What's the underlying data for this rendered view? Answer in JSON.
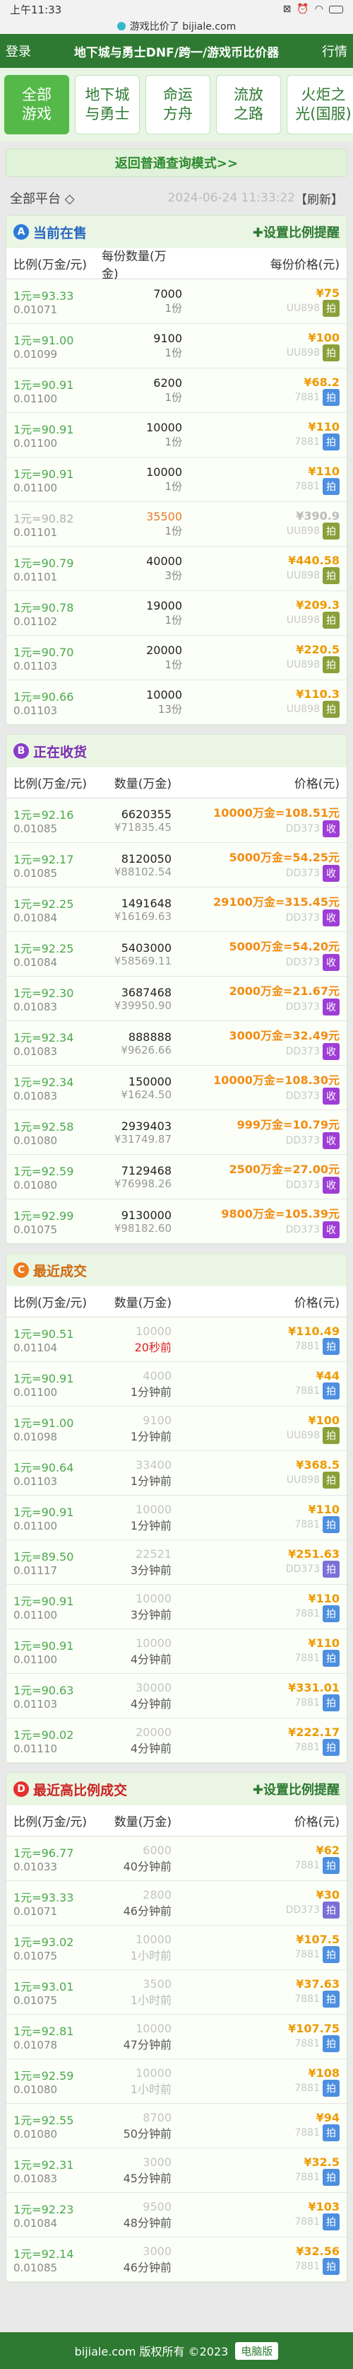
{
  "status": {
    "time": "上午11:33"
  },
  "url": {
    "text": "游戏比价了 bijiale.com"
  },
  "nav": {
    "login": "登录",
    "title": "地下城与勇士DNF/跨一/游戏币比价器",
    "rank": "行情"
  },
  "tabs": [
    "全部\n游戏",
    "地下城\n与勇士",
    "命运\n方舟",
    "流放\n之路",
    "火炬之\n光(国服)"
  ],
  "back_link": "返回普通查询模式>>",
  "filter": {
    "platform": "全部平台 ◇",
    "timestamp": "2024-06-24 11:33:22",
    "refresh": "【刷新】"
  },
  "sell": {
    "letter": "A",
    "title": "当前在售",
    "set_label": "✚设置比例提醒",
    "cols": [
      "比例(万金/元)",
      "每份数量(万金)",
      "每份价格(元)"
    ],
    "rows": [
      {
        "ratio": "1元=93.33",
        "sub": "0.01071",
        "qty": "7000",
        "share": "1份",
        "price": "¥75",
        "store": "UU898",
        "badge": "拍",
        "bc": "b-g",
        "gray": false
      },
      {
        "ratio": "1元=91.00",
        "sub": "0.01099",
        "qty": "9100",
        "share": "1份",
        "price": "¥100",
        "store": "UU898",
        "badge": "拍",
        "bc": "b-g",
        "gray": false
      },
      {
        "ratio": "1元=90.91",
        "sub": "0.01100",
        "qty": "6200",
        "share": "1份",
        "price": "¥68.2",
        "store": "7881",
        "badge": "拍",
        "bc": "b-b",
        "gray": false
      },
      {
        "ratio": "1元=90.91",
        "sub": "0.01100",
        "qty": "10000",
        "share": "1份",
        "price": "¥110",
        "store": "7881",
        "badge": "拍",
        "bc": "b-b",
        "gray": false
      },
      {
        "ratio": "1元=90.91",
        "sub": "0.01100",
        "qty": "10000",
        "share": "1份",
        "price": "¥110",
        "store": "7881",
        "badge": "拍",
        "bc": "b-b",
        "gray": false
      },
      {
        "ratio": "1元=90.82",
        "sub": "0.01101",
        "qty": "35500",
        "share": "1份",
        "price": "¥390.9",
        "store": "UU898",
        "badge": "拍",
        "bc": "b-g",
        "gray": true
      },
      {
        "ratio": "1元=90.79",
        "sub": "0.01101",
        "qty": "40000",
        "share": "3份",
        "price": "¥440.58",
        "store": "UU898",
        "badge": "拍",
        "bc": "b-g",
        "gray": false
      },
      {
        "ratio": "1元=90.78",
        "sub": "0.01102",
        "qty": "19000",
        "share": "1份",
        "price": "¥209.3",
        "store": "UU898",
        "badge": "拍",
        "bc": "b-g",
        "gray": false
      },
      {
        "ratio": "1元=90.70",
        "sub": "0.01103",
        "qty": "20000",
        "share": "1份",
        "price": "¥220.5",
        "store": "UU898",
        "badge": "拍",
        "bc": "b-g",
        "gray": false
      },
      {
        "ratio": "1元=90.66",
        "sub": "0.01103",
        "qty": "10000",
        "share": "13份",
        "price": "¥110.3",
        "store": "UU898",
        "badge": "拍",
        "bc": "b-g",
        "gray": false
      }
    ]
  },
  "buy": {
    "letter": "B",
    "title": "正在收货",
    "cols": [
      "比例(万金/元)",
      "数量(万金)",
      "价格(元)"
    ],
    "rows": [
      {
        "ratio": "1元=92.16",
        "sub": "0.01085",
        "qty": "6620355",
        "val": "¥71835.45",
        "price": "10000万金=108.51元",
        "store": "DD373",
        "badge": "收"
      },
      {
        "ratio": "1元=92.17",
        "sub": "0.01085",
        "qty": "8120050",
        "val": "¥88102.54",
        "price": "5000万金=54.25元",
        "store": "DD373",
        "badge": "收"
      },
      {
        "ratio": "1元=92.25",
        "sub": "0.01084",
        "qty": "1491648",
        "val": "¥16169.63",
        "price": "29100万金=315.45元",
        "store": "DD373",
        "badge": "收"
      },
      {
        "ratio": "1元=92.25",
        "sub": "0.01084",
        "qty": "5403000",
        "val": "¥58569.11",
        "price": "5000万金=54.20元",
        "store": "DD373",
        "badge": "收"
      },
      {
        "ratio": "1元=92.30",
        "sub": "0.01083",
        "qty": "3687468",
        "val": "¥39950.90",
        "price": "2000万金=21.67元",
        "store": "DD373",
        "badge": "收"
      },
      {
        "ratio": "1元=92.34",
        "sub": "0.01083",
        "qty": "888888",
        "val": "¥9626.66",
        "price": "3000万金=32.49元",
        "store": "DD373",
        "badge": "收"
      },
      {
        "ratio": "1元=92.34",
        "sub": "0.01083",
        "qty": "150000",
        "val": "¥1624.50",
        "price": "10000万金=108.30元",
        "store": "DD373",
        "badge": "收"
      },
      {
        "ratio": "1元=92.58",
        "sub": "0.01080",
        "qty": "2939403",
        "val": "¥31749.87",
        "price": "999万金=10.79元",
        "store": "DD373",
        "badge": "收"
      },
      {
        "ratio": "1元=92.59",
        "sub": "0.01080",
        "qty": "7129468",
        "val": "¥76998.26",
        "price": "2500万金=27.00元",
        "store": "DD373",
        "badge": "收"
      },
      {
        "ratio": "1元=92.99",
        "sub": "0.01075",
        "qty": "9130000",
        "val": "¥98182.60",
        "price": "9800万金=105.39元",
        "store": "DD373",
        "badge": "收"
      }
    ]
  },
  "recent": {
    "letter": "C",
    "title": "最近成交",
    "cols": [
      "比例(万金/元)",
      "数量(万金)",
      "价格(元)"
    ],
    "rows": [
      {
        "ratio": "1元=90.51",
        "sub": "0.01104",
        "qty": "10000",
        "time": "20秒前",
        "tred": true,
        "price": "¥110.49",
        "store": "7881",
        "badge": "拍",
        "bc": "b-b"
      },
      {
        "ratio": "1元=90.91",
        "sub": "0.01100",
        "qty": "4000",
        "time": "1分钟前",
        "tred": false,
        "price": "¥44",
        "store": "7881",
        "badge": "拍",
        "bc": "b-b"
      },
      {
        "ratio": "1元=91.00",
        "sub": "0.01098",
        "qty": "9100",
        "time": "1分钟前",
        "tred": false,
        "price": "¥100",
        "store": "UU898",
        "badge": "拍",
        "bc": "b-g"
      },
      {
        "ratio": "1元=90.64",
        "sub": "0.01103",
        "qty": "33400",
        "time": "1分钟前",
        "tred": false,
        "price": "¥368.5",
        "store": "UU898",
        "badge": "拍",
        "bc": "b-g"
      },
      {
        "ratio": "1元=90.91",
        "sub": "0.01100",
        "qty": "10000",
        "time": "1分钟前",
        "tred": false,
        "price": "¥110",
        "store": "7881",
        "badge": "拍",
        "bc": "b-b"
      },
      {
        "ratio": "1元=89.50",
        "sub": "0.01117",
        "qty": "22521",
        "time": "3分钟前",
        "tred": false,
        "price": "¥251.63",
        "store": "DD373",
        "badge": "拍",
        "bc": "b-v"
      },
      {
        "ratio": "1元=90.91",
        "sub": "0.01100",
        "qty": "10000",
        "time": "3分钟前",
        "tred": false,
        "price": "¥110",
        "store": "7881",
        "badge": "拍",
        "bc": "b-b"
      },
      {
        "ratio": "1元=90.91",
        "sub": "0.01100",
        "qty": "10000",
        "time": "4分钟前",
        "tred": false,
        "price": "¥110",
        "store": "7881",
        "badge": "拍",
        "bc": "b-b"
      },
      {
        "ratio": "1元=90.63",
        "sub": "0.01103",
        "qty": "30000",
        "time": "4分钟前",
        "tred": false,
        "price": "¥331.01",
        "store": "7881",
        "badge": "拍",
        "bc": "b-b"
      },
      {
        "ratio": "1元=90.02",
        "sub": "0.01110",
        "qty": "20000",
        "time": "4分钟前",
        "tred": false,
        "price": "¥222.17",
        "store": "7881",
        "badge": "拍",
        "bc": "b-b"
      }
    ]
  },
  "high": {
    "letter": "D",
    "title": "最近高比例成交",
    "set_label": "✚设置比例提醒",
    "cols": [
      "比例(万金/元)",
      "数量(万金)",
      "价格(元)"
    ],
    "rows": [
      {
        "ratio": "1元=96.77",
        "sub": "0.01033",
        "qty": "6000",
        "time": "40分钟前",
        "tgray": false,
        "price": "¥62",
        "store": "7881",
        "badge": "拍",
        "bc": "b-b"
      },
      {
        "ratio": "1元=93.33",
        "sub": "0.01071",
        "qty": "2800",
        "time": "46分钟前",
        "tgray": false,
        "price": "¥30",
        "store": "DD373",
        "badge": "拍",
        "bc": "b-v"
      },
      {
        "ratio": "1元=93.02",
        "sub": "0.01075",
        "qty": "10000",
        "time": "1小时前",
        "tgray": true,
        "price": "¥107.5",
        "store": "7881",
        "badge": "拍",
        "bc": "b-b"
      },
      {
        "ratio": "1元=93.01",
        "sub": "0.01075",
        "qty": "3500",
        "time": "1小时前",
        "tgray": true,
        "price": "¥37.63",
        "store": "7881",
        "badge": "拍",
        "bc": "b-b"
      },
      {
        "ratio": "1元=92.81",
        "sub": "0.01078",
        "qty": "10000",
        "time": "47分钟前",
        "tgray": false,
        "price": "¥107.75",
        "store": "7881",
        "badge": "拍",
        "bc": "b-b"
      },
      {
        "ratio": "1元=92.59",
        "sub": "0.01080",
        "qty": "10000",
        "time": "1小时前",
        "tgray": true,
        "price": "¥108",
        "store": "7881",
        "badge": "拍",
        "bc": "b-b"
      },
      {
        "ratio": "1元=92.55",
        "sub": "0.01080",
        "qty": "8700",
        "time": "50分钟前",
        "tgray": false,
        "price": "¥94",
        "store": "7881",
        "badge": "拍",
        "bc": "b-b"
      },
      {
        "ratio": "1元=92.31",
        "sub": "0.01083",
        "qty": "3000",
        "time": "45分钟前",
        "tgray": false,
        "price": "¥32.5",
        "store": "7881",
        "badge": "拍",
        "bc": "b-b"
      },
      {
        "ratio": "1元=92.23",
        "sub": "0.01084",
        "qty": "9500",
        "time": "48分钟前",
        "tgray": false,
        "price": "¥103",
        "store": "7881",
        "badge": "拍",
        "bc": "b-b"
      },
      {
        "ratio": "1元=92.14",
        "sub": "0.01085",
        "qty": "3000",
        "time": "46分钟前",
        "tgray": false,
        "price": "¥32.56",
        "store": "7881",
        "badge": "拍",
        "bc": "b-b"
      }
    ]
  },
  "footer": {
    "text": "bijiale.com 版权所有 ©2023",
    "pc": "电脑版"
  }
}
